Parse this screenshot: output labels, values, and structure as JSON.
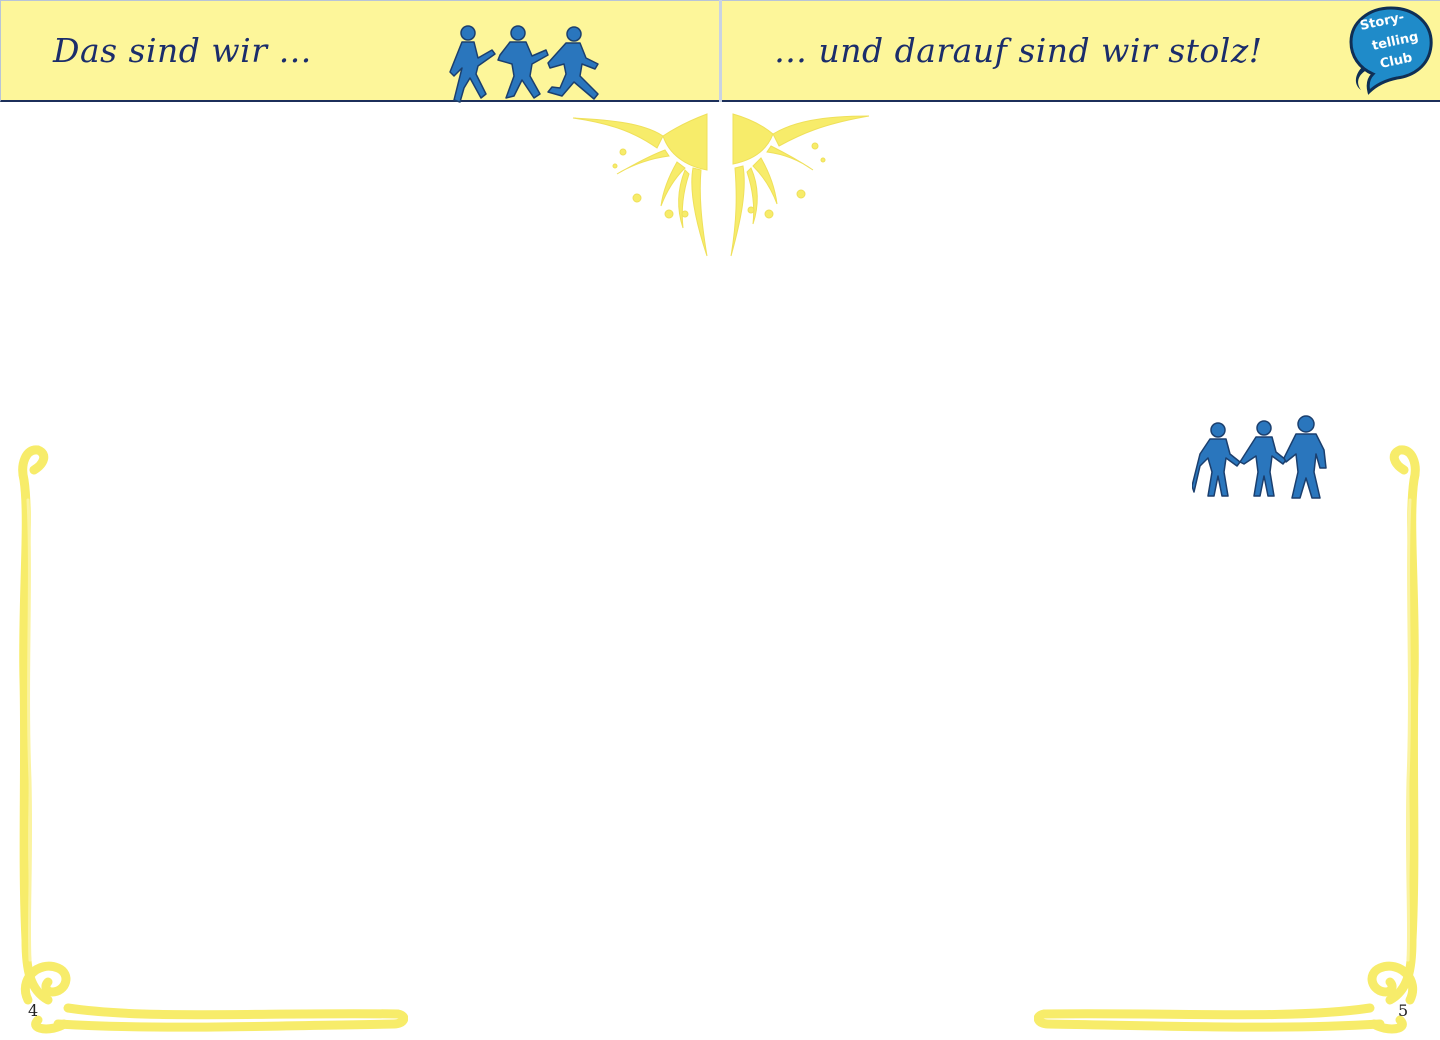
{
  "left_page": {
    "header_title": "Das sind wir …",
    "page_number": "4",
    "icon": "running-people-icon"
  },
  "right_page": {
    "header_title": "… und darauf sind wir stolz!",
    "page_number": "5",
    "icon": "holding-hands-people-icon"
  },
  "logo": {
    "line1": "Story-",
    "line2": "telling",
    "line3": "Club",
    "icon": "speech-bubble-logo"
  },
  "colors": {
    "header_bg": "#fdf69a",
    "title_text": "#1b2d6b",
    "figure_blue": "#2a76bd",
    "ornament_yellow": "#f7ec6a",
    "logo_blue": "#1f8bc9"
  }
}
